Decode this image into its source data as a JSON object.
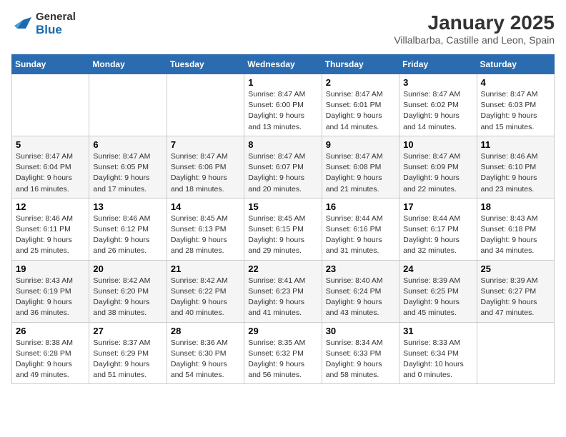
{
  "header": {
    "logo_general": "General",
    "logo_blue": "Blue",
    "title": "January 2025",
    "subtitle": "Villalbarba, Castille and Leon, Spain"
  },
  "weekdays": [
    "Sunday",
    "Monday",
    "Tuesday",
    "Wednesday",
    "Thursday",
    "Friday",
    "Saturday"
  ],
  "weeks": [
    [
      {
        "day": "",
        "info": ""
      },
      {
        "day": "",
        "info": ""
      },
      {
        "day": "",
        "info": ""
      },
      {
        "day": "1",
        "info": "Sunrise: 8:47 AM\nSunset: 6:00 PM\nDaylight: 9 hours\nand 13 minutes."
      },
      {
        "day": "2",
        "info": "Sunrise: 8:47 AM\nSunset: 6:01 PM\nDaylight: 9 hours\nand 14 minutes."
      },
      {
        "day": "3",
        "info": "Sunrise: 8:47 AM\nSunset: 6:02 PM\nDaylight: 9 hours\nand 14 minutes."
      },
      {
        "day": "4",
        "info": "Sunrise: 8:47 AM\nSunset: 6:03 PM\nDaylight: 9 hours\nand 15 minutes."
      }
    ],
    [
      {
        "day": "5",
        "info": "Sunrise: 8:47 AM\nSunset: 6:04 PM\nDaylight: 9 hours\nand 16 minutes."
      },
      {
        "day": "6",
        "info": "Sunrise: 8:47 AM\nSunset: 6:05 PM\nDaylight: 9 hours\nand 17 minutes."
      },
      {
        "day": "7",
        "info": "Sunrise: 8:47 AM\nSunset: 6:06 PM\nDaylight: 9 hours\nand 18 minutes."
      },
      {
        "day": "8",
        "info": "Sunrise: 8:47 AM\nSunset: 6:07 PM\nDaylight: 9 hours\nand 20 minutes."
      },
      {
        "day": "9",
        "info": "Sunrise: 8:47 AM\nSunset: 6:08 PM\nDaylight: 9 hours\nand 21 minutes."
      },
      {
        "day": "10",
        "info": "Sunrise: 8:47 AM\nSunset: 6:09 PM\nDaylight: 9 hours\nand 22 minutes."
      },
      {
        "day": "11",
        "info": "Sunrise: 8:46 AM\nSunset: 6:10 PM\nDaylight: 9 hours\nand 23 minutes."
      }
    ],
    [
      {
        "day": "12",
        "info": "Sunrise: 8:46 AM\nSunset: 6:11 PM\nDaylight: 9 hours\nand 25 minutes."
      },
      {
        "day": "13",
        "info": "Sunrise: 8:46 AM\nSunset: 6:12 PM\nDaylight: 9 hours\nand 26 minutes."
      },
      {
        "day": "14",
        "info": "Sunrise: 8:45 AM\nSunset: 6:13 PM\nDaylight: 9 hours\nand 28 minutes."
      },
      {
        "day": "15",
        "info": "Sunrise: 8:45 AM\nSunset: 6:15 PM\nDaylight: 9 hours\nand 29 minutes."
      },
      {
        "day": "16",
        "info": "Sunrise: 8:44 AM\nSunset: 6:16 PM\nDaylight: 9 hours\nand 31 minutes."
      },
      {
        "day": "17",
        "info": "Sunrise: 8:44 AM\nSunset: 6:17 PM\nDaylight: 9 hours\nand 32 minutes."
      },
      {
        "day": "18",
        "info": "Sunrise: 8:43 AM\nSunset: 6:18 PM\nDaylight: 9 hours\nand 34 minutes."
      }
    ],
    [
      {
        "day": "19",
        "info": "Sunrise: 8:43 AM\nSunset: 6:19 PM\nDaylight: 9 hours\nand 36 minutes."
      },
      {
        "day": "20",
        "info": "Sunrise: 8:42 AM\nSunset: 6:20 PM\nDaylight: 9 hours\nand 38 minutes."
      },
      {
        "day": "21",
        "info": "Sunrise: 8:42 AM\nSunset: 6:22 PM\nDaylight: 9 hours\nand 40 minutes."
      },
      {
        "day": "22",
        "info": "Sunrise: 8:41 AM\nSunset: 6:23 PM\nDaylight: 9 hours\nand 41 minutes."
      },
      {
        "day": "23",
        "info": "Sunrise: 8:40 AM\nSunset: 6:24 PM\nDaylight: 9 hours\nand 43 minutes."
      },
      {
        "day": "24",
        "info": "Sunrise: 8:39 AM\nSunset: 6:25 PM\nDaylight: 9 hours\nand 45 minutes."
      },
      {
        "day": "25",
        "info": "Sunrise: 8:39 AM\nSunset: 6:27 PM\nDaylight: 9 hours\nand 47 minutes."
      }
    ],
    [
      {
        "day": "26",
        "info": "Sunrise: 8:38 AM\nSunset: 6:28 PM\nDaylight: 9 hours\nand 49 minutes."
      },
      {
        "day": "27",
        "info": "Sunrise: 8:37 AM\nSunset: 6:29 PM\nDaylight: 9 hours\nand 51 minutes."
      },
      {
        "day": "28",
        "info": "Sunrise: 8:36 AM\nSunset: 6:30 PM\nDaylight: 9 hours\nand 54 minutes."
      },
      {
        "day": "29",
        "info": "Sunrise: 8:35 AM\nSunset: 6:32 PM\nDaylight: 9 hours\nand 56 minutes."
      },
      {
        "day": "30",
        "info": "Sunrise: 8:34 AM\nSunset: 6:33 PM\nDaylight: 9 hours\nand 58 minutes."
      },
      {
        "day": "31",
        "info": "Sunrise: 8:33 AM\nSunset: 6:34 PM\nDaylight: 10 hours\nand 0 minutes."
      },
      {
        "day": "",
        "info": ""
      }
    ]
  ]
}
